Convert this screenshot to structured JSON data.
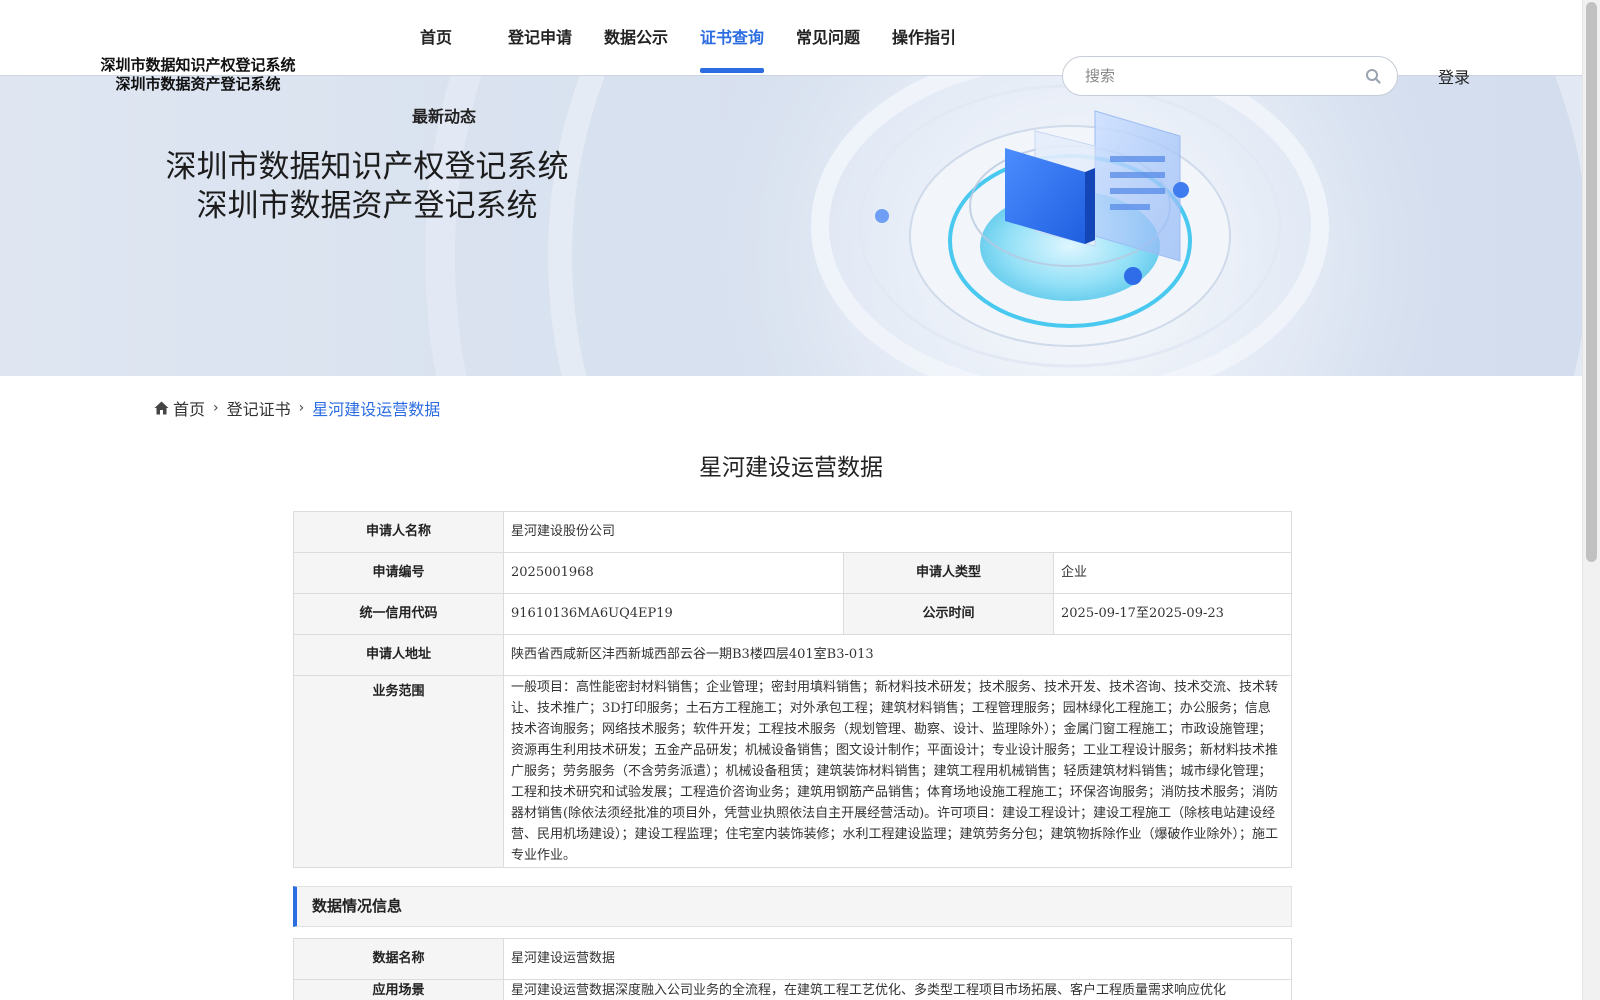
{
  "logo": {
    "line1": "深圳市数据知识产权登记系统",
    "line2": "深圳市数据资产登记系统"
  },
  "nav": {
    "items": [
      {
        "label": "首页",
        "active": false
      },
      {
        "label": "登记申请",
        "active": false
      },
      {
        "label": "数据公示",
        "active": false
      },
      {
        "label": "证书查询",
        "active": true
      },
      {
        "label": "常见问题",
        "active": false
      },
      {
        "label": "操作指引",
        "active": false
      }
    ],
    "second_row": "最新动态",
    "active_color": "#2b6de0"
  },
  "search": {
    "placeholder": "搜索",
    "icon": "search-icon"
  },
  "login_label": "登录",
  "banner": {
    "line1": "深圳市数据知识产权登记系统",
    "line2": "深圳市数据资产登记系统"
  },
  "breadcrumb": {
    "home": "首页",
    "level2": "登记证书",
    "current": "星河建设运营数据",
    "icon": "home-icon"
  },
  "page_title": "星河建设运营数据",
  "applicant": {
    "name_label": "申请人名称",
    "name_value": "星河建设股份公司",
    "app_no_label": "申请编号",
    "app_no_value": "2025001968",
    "type_label": "申请人类型",
    "type_value": "企业",
    "credit_label": "统一信用代码",
    "credit_value": "91610136MA6UQ4EP19",
    "publicity_label": "公示时间",
    "publicity_value": "2025-09-17至2025-09-23",
    "address_label": "申请人地址",
    "address_value": "陕西省西咸新区沣西新城西部云谷一期B3楼四层401室B3-013",
    "scope_label": "业务范围",
    "scope_value": "一般项目：高性能密封材料销售；企业管理；密封用填料销售；新材料技术研发；技术服务、技术开发、技术咨询、技术交流、技术转让、技术推广；3D打印服务；土石方工程施工；对外承包工程；建筑材料销售；工程管理服务；园林绿化工程施工；办公服务；信息技术咨询服务；网络技术服务；软件开发；工程技术服务（规划管理、勘察、设计、监理除外）；金属门窗工程施工；市政设施管理；资源再生利用技术研发；五金产品研发；机械设备销售；图文设计制作；平面设计；专业设计服务；工业工程设计服务；新材料技术推广服务；劳务服务（不含劳务派遣）；机械设备租赁；建筑装饰材料销售；建筑工程用机械销售；轻质建筑材料销售；城市绿化管理；工程和技术研究和试验发展；工程造价咨询业务；建筑用钢筋产品销售；体育场地设施工程施工；环保咨询服务；消防技术服务；消防器材销售(除依法须经批准的项目外，凭营业执照依法自主开展经营活动)。许可项目：建设工程设计；建设工程施工（除核电站建设经营、民用机场建设）；建设工程监理；住宅室内装饰装修；水利工程建设监理；建筑劳务分包；建筑物拆除作业（爆破作业除外）；施工专业作业。"
  },
  "data_section": {
    "title": "数据情况信息",
    "data_name_label": "数据名称",
    "data_name_value": "星河建设运营数据",
    "scene_label": "应用场景",
    "scene_value": "星河建设运营数据深度融入公司业务的全流程，在建筑工程工艺优化、多类型工程项目市场拓展、客户工程质量需求响应优化"
  }
}
